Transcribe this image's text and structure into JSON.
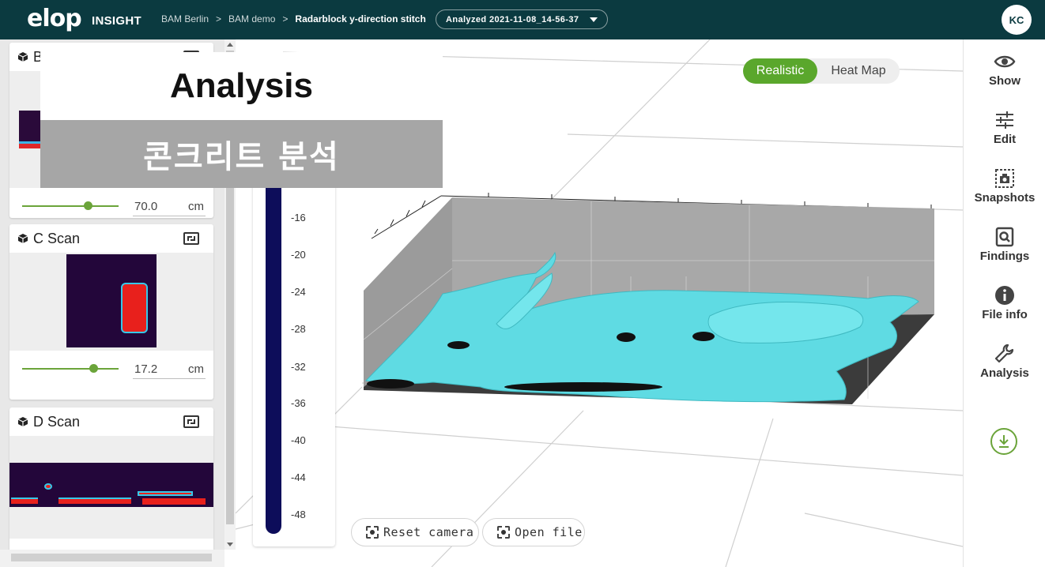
{
  "header": {
    "logo": "elop",
    "brand": "INSIGHT",
    "breadcrumbs": [
      "BAM Berlin",
      "BAM demo",
      "Radarblock y-direction stitch"
    ],
    "separator": ">",
    "analysis_selector": "Analyzed 2021-11-08_14-56-37",
    "user_initials": "KC"
  },
  "overlay": {
    "title": "Analysis",
    "subtitle": "콘크리트 분석"
  },
  "panels": {
    "b_scan": {
      "title_initial": "B",
      "slider_value": "70.0",
      "slider_fraction": 0.68,
      "unit": "cm"
    },
    "c_scan": {
      "title": "C Scan",
      "slider_value": "17.2",
      "slider_fraction": 0.74,
      "unit": "cm"
    },
    "d_scan": {
      "title": "D Scan"
    }
  },
  "viewport": {
    "view_modes": [
      "Realistic",
      "Heat Map"
    ],
    "active_view_mode": "Realistic",
    "colorbar_labels": [
      "-16",
      "-20",
      "-24",
      "-28",
      "-32",
      "-36",
      "-40",
      "-44",
      "-48"
    ],
    "buttons": {
      "reset_camera": "Reset camera",
      "open_file": "Open file"
    }
  },
  "sidebar": {
    "items": [
      {
        "label": "Show",
        "icon": "eye-icon"
      },
      {
        "label": "Edit",
        "icon": "sliders-icon"
      },
      {
        "label": "Snapshots",
        "icon": "camera-icon"
      },
      {
        "label": "Findings",
        "icon": "document-search-icon"
      },
      {
        "label": "File info",
        "icon": "info-icon"
      },
      {
        "label": "Analysis",
        "icon": "wrench-icon"
      }
    ],
    "download_icon": "download-icon"
  },
  "colors": {
    "header_bg": "#0b3a40",
    "accent_green": "#5aa72c",
    "surface_cyan": "#5fdbe3",
    "colorbar": "#0d0d5a"
  }
}
